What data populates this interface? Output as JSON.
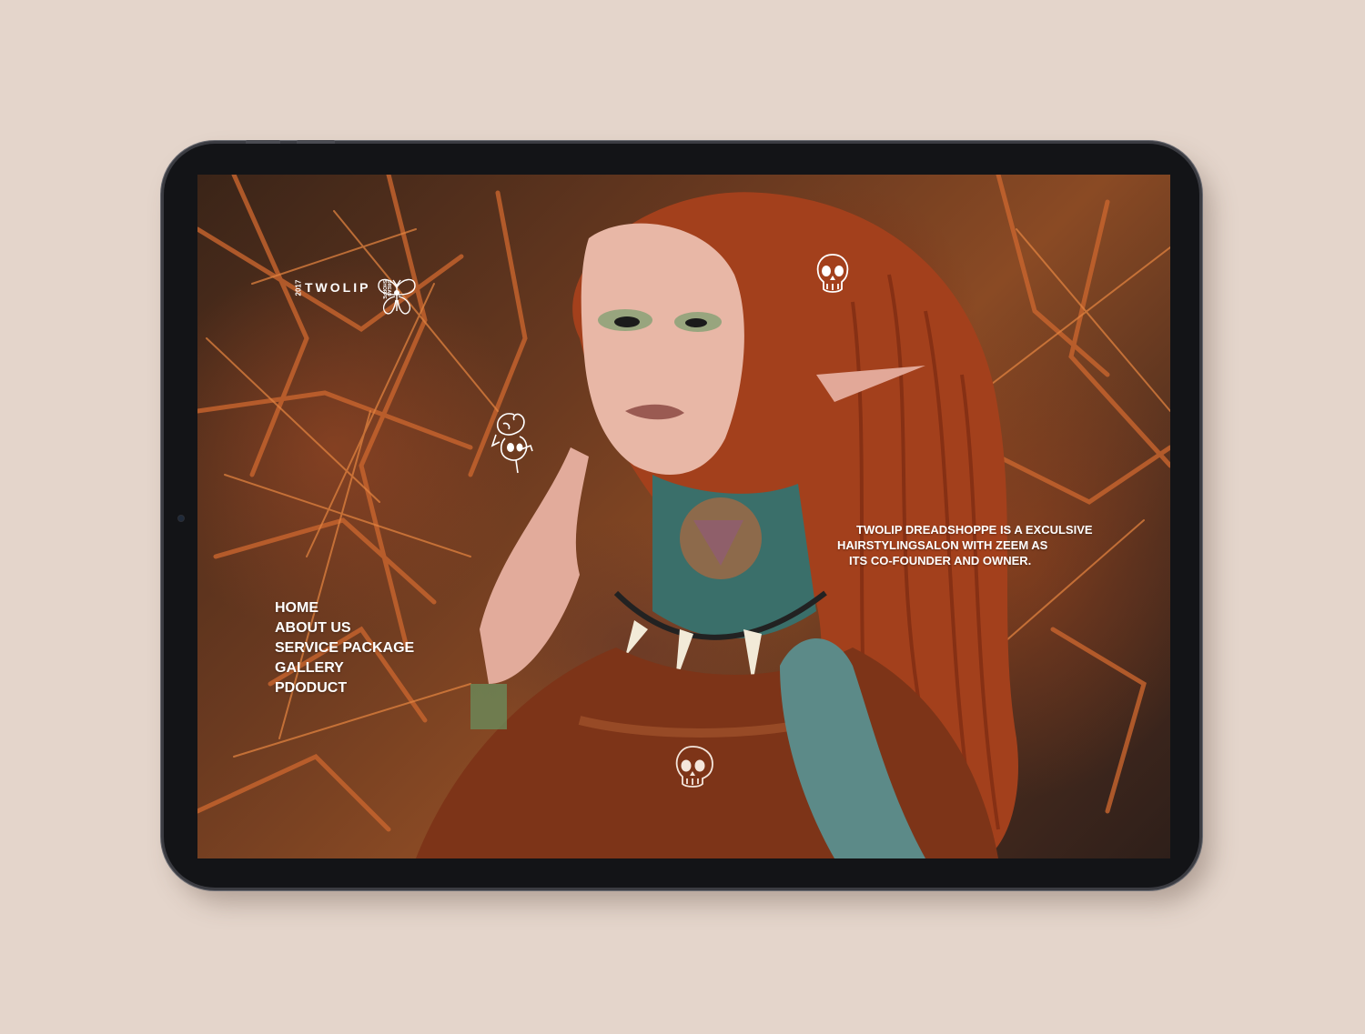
{
  "brand": {
    "year": "2017",
    "name": "TWOLIP",
    "tagline": "DREAD SHOPPE"
  },
  "nav": {
    "items": [
      {
        "label": "HOME"
      },
      {
        "label": "ABOUT US"
      },
      {
        "label": "SERVICE PACKAGE"
      },
      {
        "label": "GALLERY"
      },
      {
        "label": "PDODUCT"
      }
    ]
  },
  "intro": {
    "lines": [
      "TWOLIP DREADSHOPPE IS A EXCULSIVE",
      "HAIRSTYLINGSALON WITH ZEEM AS",
      "ITS CO-FOUNDER AND OWNER."
    ]
  },
  "icons": {
    "logo": "butterfly-icon",
    "top_right": "skull-icon",
    "left": "rose-skull-icon",
    "bottom": "skull-icon"
  },
  "colors": {
    "backdrop": "#e4d5cb",
    "device": "#131417",
    "text": "#ffffff"
  }
}
